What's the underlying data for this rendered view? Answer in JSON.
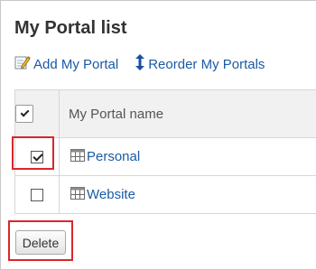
{
  "page": {
    "title": "My Portal list"
  },
  "toolbar": {
    "add_label": "Add My Portal",
    "reorder_label": "Reorder My Portals"
  },
  "table": {
    "name_header": "My Portal name",
    "rows": [
      {
        "name": "Personal",
        "checked": true
      },
      {
        "name": "Website",
        "checked": false
      }
    ]
  },
  "actions": {
    "delete_label": "Delete"
  },
  "colors": {
    "link": "#1a5aa6",
    "highlight": "#d9262c",
    "header_bg": "#f1f1f1"
  },
  "icons": {
    "add": "edit-pencil-icon",
    "reorder": "vertical-arrows-icon",
    "portal": "portal-grid-icon"
  }
}
